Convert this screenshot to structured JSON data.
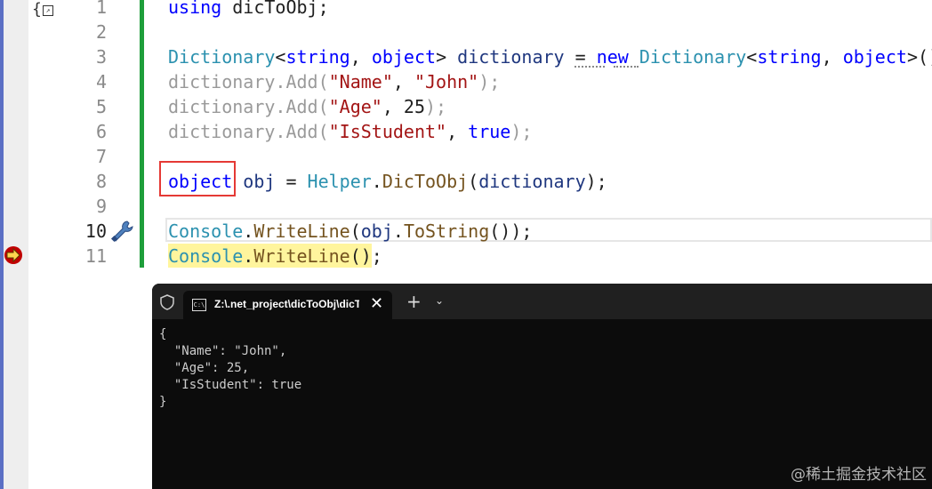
{
  "editor": {
    "line_numbers": [
      "1",
      "2",
      "3",
      "4",
      "5",
      "6",
      "7",
      "8",
      "9",
      "10",
      "11"
    ],
    "lines": [
      [
        {
          "t": "using",
          "c": "kw"
        },
        {
          "t": " dicToObj;",
          "c": "plain"
        }
      ],
      [],
      [
        {
          "t": "Dictionary",
          "c": "ty"
        },
        {
          "t": "<",
          "c": "plain"
        },
        {
          "t": "string",
          "c": "kw"
        },
        {
          "t": ", ",
          "c": "plain"
        },
        {
          "t": "object",
          "c": "kw"
        },
        {
          "t": "> ",
          "c": "plain"
        },
        {
          "t": "dictionary",
          "c": "id"
        },
        {
          "t": " = ",
          "c": "plain"
        },
        {
          "t": "new",
          "c": "kw"
        },
        {
          "t": " ",
          "c": "plain"
        },
        {
          "t": "Dictionary",
          "c": "ty"
        },
        {
          "t": "<",
          "c": "plain"
        },
        {
          "t": "string",
          "c": "kw"
        },
        {
          "t": ", ",
          "c": "plain"
        },
        {
          "t": "object",
          "c": "kw"
        },
        {
          "t": ">();",
          "c": "plain"
        }
      ],
      [
        {
          "t": "dictionary.Add(",
          "c": "dim"
        },
        {
          "t": "\"Name\"",
          "c": "str"
        },
        {
          "t": ", ",
          "c": "plain"
        },
        {
          "t": "\"John\"",
          "c": "str"
        },
        {
          "t": ");",
          "c": "dim"
        }
      ],
      [
        {
          "t": "dictionary.Add(",
          "c": "dim"
        },
        {
          "t": "\"Age\"",
          "c": "str"
        },
        {
          "t": ", 25",
          "c": "plain"
        },
        {
          "t": ");",
          "c": "dim"
        }
      ],
      [
        {
          "t": "dictionary.Add(",
          "c": "dim"
        },
        {
          "t": "\"IsStudent\"",
          "c": "str"
        },
        {
          "t": ", ",
          "c": "plain"
        },
        {
          "t": "true",
          "c": "kw"
        },
        {
          "t": ");",
          "c": "dim"
        }
      ],
      [],
      [
        {
          "t": "object",
          "c": "kw"
        },
        {
          "t": " ",
          "c": "plain"
        },
        {
          "t": "obj",
          "c": "id"
        },
        {
          "t": " = ",
          "c": "plain"
        },
        {
          "t": "Helper",
          "c": "ty"
        },
        {
          "t": ".",
          "c": "plain"
        },
        {
          "t": "DicToObj",
          "c": "fn"
        },
        {
          "t": "(",
          "c": "plain"
        },
        {
          "t": "dictionary",
          "c": "id"
        },
        {
          "t": ");",
          "c": "plain"
        }
      ],
      [],
      [
        {
          "t": "Console",
          "c": "ty"
        },
        {
          "t": ".",
          "c": "plain"
        },
        {
          "t": "WriteLine",
          "c": "fn"
        },
        {
          "t": "(",
          "c": "plain"
        },
        {
          "t": "obj",
          "c": "id"
        },
        {
          "t": ".",
          "c": "plain"
        },
        {
          "t": "ToString",
          "c": "fn"
        },
        {
          "t": "());",
          "c": "plain"
        }
      ],
      [
        {
          "t": "Console",
          "c": "ty"
        },
        {
          "t": ".",
          "c": "plain"
        },
        {
          "t": "WriteLine",
          "c": "fn"
        },
        {
          "t": "();",
          "c": "plain"
        }
      ]
    ],
    "current_line": "10"
  },
  "terminal": {
    "tab_title": "Z:\\.net_project\\dicToObj\\dicTo",
    "tab_icon_text": "C:\\",
    "close_glyph": "✕",
    "new_tab_glyph": "+",
    "dropdown_glyph": "⌄",
    "output": [
      "{",
      "  \"Name\": \"John\",",
      "  \"Age\": 25,",
      "  \"IsStudent\": true",
      "}"
    ]
  },
  "watermark": "@稀土掘金技术社区",
  "gutter_icon_text": "{",
  "icons": {
    "collapse": "collapse-icon",
    "breakpoint": "breakpoint-arrow-icon",
    "wrench": "wrench-icon",
    "shield": "shield-icon"
  }
}
